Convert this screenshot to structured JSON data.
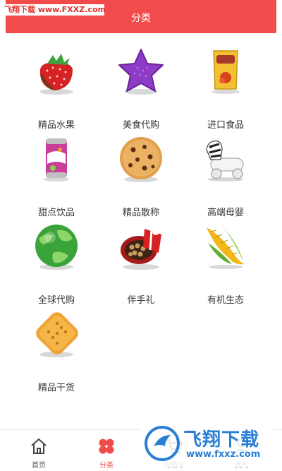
{
  "watermark_top": "飞翔下载 www.FXXZ.com",
  "header": {
    "title": "分类"
  },
  "categories": [
    {
      "label": "精品水果",
      "icon": "strawberry-icon"
    },
    {
      "label": "美食代购",
      "icon": "purple-star-icon"
    },
    {
      "label": "进口食品",
      "icon": "chips-bag-icon"
    },
    {
      "label": "甜点饮品",
      "icon": "soda-can-icon"
    },
    {
      "label": "精品散称",
      "icon": "cookie-icon"
    },
    {
      "label": "高端母婴",
      "icon": "zebra-toy-icon"
    },
    {
      "label": "全球代购",
      "icon": "globe-icon"
    },
    {
      "label": "伴手礼",
      "icon": "gift-box-icon"
    },
    {
      "label": "有机生态",
      "icon": "corn-icon"
    },
    {
      "label": "精品干货",
      "icon": "cracker-icon"
    }
  ],
  "bottom_nav": [
    {
      "label": "首页",
      "icon": "home-icon"
    },
    {
      "label": "分类",
      "icon": "category-grid-icon",
      "active": true
    },
    {
      "label": "购物车",
      "icon": "cart-icon"
    },
    {
      "label": "我的",
      "icon": "user-icon"
    }
  ],
  "watermark_bottom": {
    "line1": "飞翔下载",
    "line2": "www.fxxz.com"
  },
  "colors": {
    "accent": "#f24b4b",
    "watermark_blue": "#2a7fd4"
  }
}
